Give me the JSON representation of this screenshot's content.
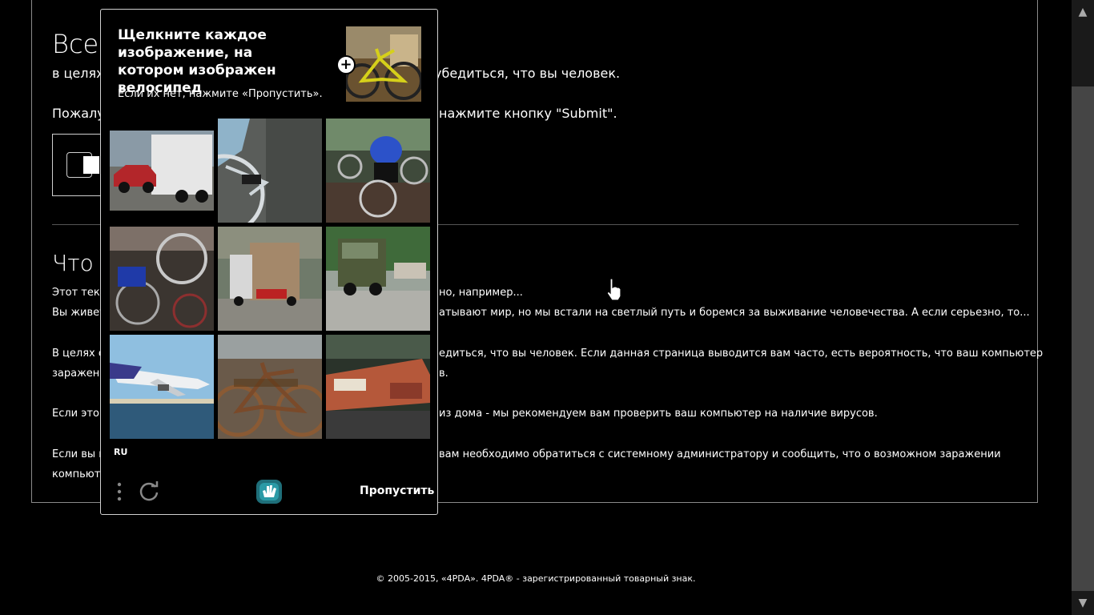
{
  "page": {
    "heading": "Все",
    "subtitle_left": "в целях",
    "subtitle_right": "убедиться, что вы человек.",
    "please_left": "Пожалу",
    "please_right": "нажмите кнопку \"Submit\".",
    "section_heading": "Что",
    "paragraphs": [
      {
        "left": "Этот текс",
        "right": "но, например..."
      },
      {
        "left": "Вы живет",
        "right": "атывают мир, но мы встали на светлый путь и боремся за выживание человечества. А если серьезно, то..."
      },
      {
        "left": "В целях о",
        "right": "едиться, что вы человек. Если данная страница выводится вам часто, есть вероятность, что ваш компьютер"
      },
      {
        "left": "заражен",
        "right": "в."
      },
      {
        "left": "Если это в",
        "right": "из дома - мы рекомендуем вам проверить ваш компьютер на наличие вирусов."
      },
      {
        "left": "Если вы п",
        "right": "вам необходимо обратиться с системному администратору и сообщить, что о возможном заражении"
      },
      {
        "left": "компьюте",
        "right": ""
      }
    ],
    "footer": "© 2005-2015, «4PDA». 4PDA® - зарегистрированный товарный знак."
  },
  "captcha": {
    "title": "Щелкните каждое изображение, на котором изображен велосипед",
    "hint": "Если их нет, нажмите «Пропустить».",
    "language": "RU",
    "skip_label": "Пропустить",
    "tiles": [
      {
        "icon": "truck-car-image"
      },
      {
        "icon": "bicycle-wheel-image"
      },
      {
        "icon": "cyclists-image"
      },
      {
        "icon": "bicycle-shop-image"
      },
      {
        "icon": "truck-image"
      },
      {
        "icon": "military-truck-image"
      },
      {
        "icon": "airplane-image"
      },
      {
        "icon": "rusty-bicycle-image"
      },
      {
        "icon": "train-image"
      }
    ]
  },
  "colors": {
    "background": "#000000",
    "text": "#ffffff",
    "accent": "#2a9aa6"
  }
}
